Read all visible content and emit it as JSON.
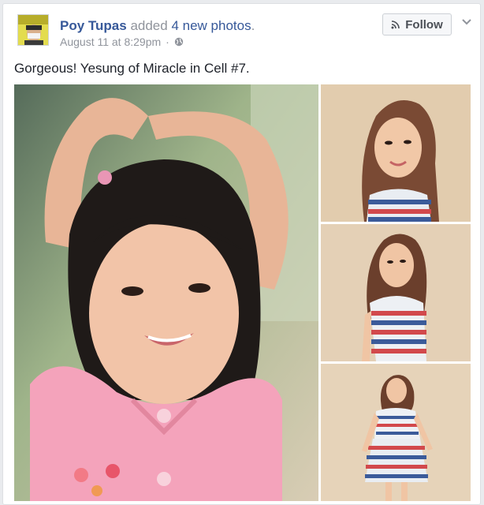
{
  "post": {
    "author": "Poy Tupas",
    "action_prefix": "added",
    "action_link": "4 new photos",
    "action_suffix": ".",
    "timestamp": "August 11 at 8:29pm",
    "separator": "·",
    "privacy_icon": "globe-icon",
    "follow_label": "Follow",
    "menu_icon": "chevron-down-icon",
    "caption": "Gorgeous! Yesung of Miracle in Cell #7."
  },
  "photos": [
    {
      "subject": "girl-pink-shirt-heart-arms"
    },
    {
      "subject": "girl-striped-top-portrait"
    },
    {
      "subject": "girl-striped-top-half-body"
    },
    {
      "subject": "girl-striped-dress-full-body"
    }
  ],
  "colors": {
    "link": "#365899",
    "meta": "#90949c",
    "text": "#1d2129",
    "card_border": "#dddfe2",
    "background": "#e9ebee"
  }
}
